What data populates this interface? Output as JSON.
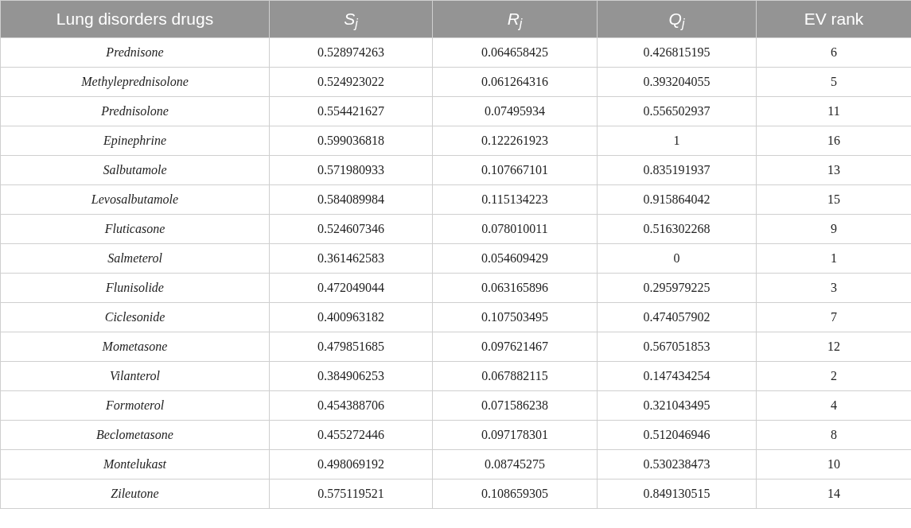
{
  "table": {
    "columns": [
      "Lung disorders drugs",
      "S$_{j}$",
      "R$_{j}$",
      "Q$_{j}$",
      "EV rank"
    ],
    "column_italic": [
      false,
      true,
      true,
      true,
      false
    ],
    "rows": [
      [
        "Prednisone",
        "0.528974263",
        "0.064658425",
        "0.426815195",
        "6"
      ],
      [
        "Methyleprednisolone",
        "0.524923022",
        "0.061264316",
        "0.393204055",
        "5"
      ],
      [
        "Prednisolone",
        "0.554421627",
        "0.07495934",
        "0.556502937",
        "11"
      ],
      [
        "Epinephrine",
        "0.599036818",
        "0.122261923",
        "1",
        "16"
      ],
      [
        "Salbutamole",
        "0.571980933",
        "0.107667101",
        "0.835191937",
        "13"
      ],
      [
        "Levosalbutamole",
        "0.584089984",
        "0.115134223",
        "0.915864042",
        "15"
      ],
      [
        "Fluticasone",
        "0.524607346",
        "0.078010011",
        "0.516302268",
        "9"
      ],
      [
        "Salmeterol",
        "0.361462583",
        "0.054609429",
        "0",
        "1"
      ],
      [
        "Flunisolide",
        "0.472049044",
        "0.063165896",
        "0.295979225",
        "3"
      ],
      [
        "Ciclesonide",
        "0.400963182",
        "0.107503495",
        "0.474057902",
        "7"
      ],
      [
        "Mometasone",
        "0.479851685",
        "0.097621467",
        "0.567051853",
        "12"
      ],
      [
        "Vilanterol",
        "0.384906253",
        "0.067882115",
        "0.147434254",
        "2"
      ],
      [
        "Formoterol",
        "0.454388706",
        "0.071586238",
        "0.321043495",
        "4"
      ],
      [
        "Beclometasone",
        "0.455272446",
        "0.097178301",
        "0.512046946",
        "8"
      ],
      [
        "Montelukast",
        "0.498069192",
        "0.08745275",
        "0.530238473",
        "10"
      ],
      [
        "Zileutone",
        "0.575119521",
        "0.108659305",
        "0.849130515",
        "14"
      ]
    ]
  }
}
